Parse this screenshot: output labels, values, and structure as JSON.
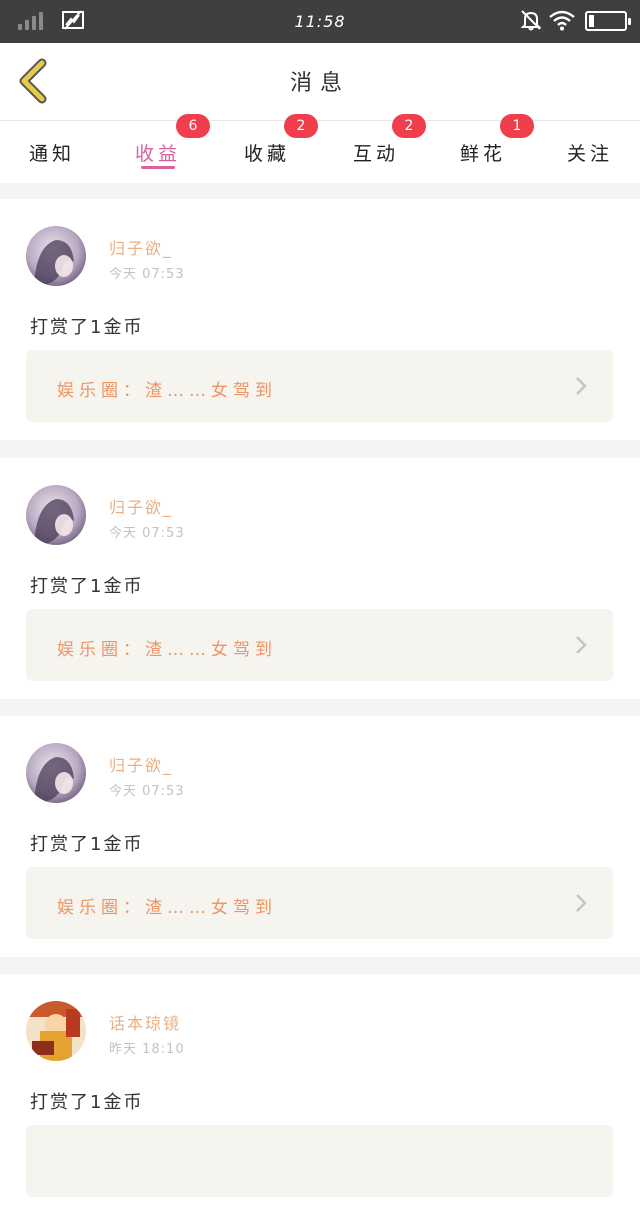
{
  "status_bar": {
    "time": "11:58",
    "icons": [
      "signal-icon",
      "no-sim-icon",
      "mute-icon",
      "wifi-icon",
      "battery-icon"
    ]
  },
  "header": {
    "title": "消息",
    "back_icon": "chevron-left-icon"
  },
  "colors": {
    "accent": "#d9619e",
    "badge": "#f03e4c",
    "username": "#e8b083",
    "link_text": "#ef9462",
    "link_bg": "#f5f4ee",
    "back_arrow": "#e7cc4a"
  },
  "tabs": [
    {
      "label": "通知",
      "badge": ""
    },
    {
      "label": "收益",
      "badge": "6",
      "active": true
    },
    {
      "label": "收藏",
      "badge": "2"
    },
    {
      "label": "互动",
      "badge": "2"
    },
    {
      "label": "鲜花",
      "badge": "1"
    },
    {
      "label": "关注",
      "badge": ""
    }
  ],
  "messages": [
    {
      "user": "归子欲_",
      "time": "今天 07:53",
      "action": "打赏了1金币",
      "link": "娱乐圈：渣……女驾到"
    },
    {
      "user": "归子欲_",
      "time": "今天 07:53",
      "action": "打赏了1金币",
      "link": "娱乐圈：渣……女驾到"
    },
    {
      "user": "归子欲_",
      "time": "今天 07:53",
      "action": "打赏了1金币",
      "link": "娱乐圈：渣……女驾到"
    },
    {
      "user": "话本琼镜",
      "time": "昨天 18:10",
      "action": "打赏了1金币",
      "link": ""
    }
  ]
}
